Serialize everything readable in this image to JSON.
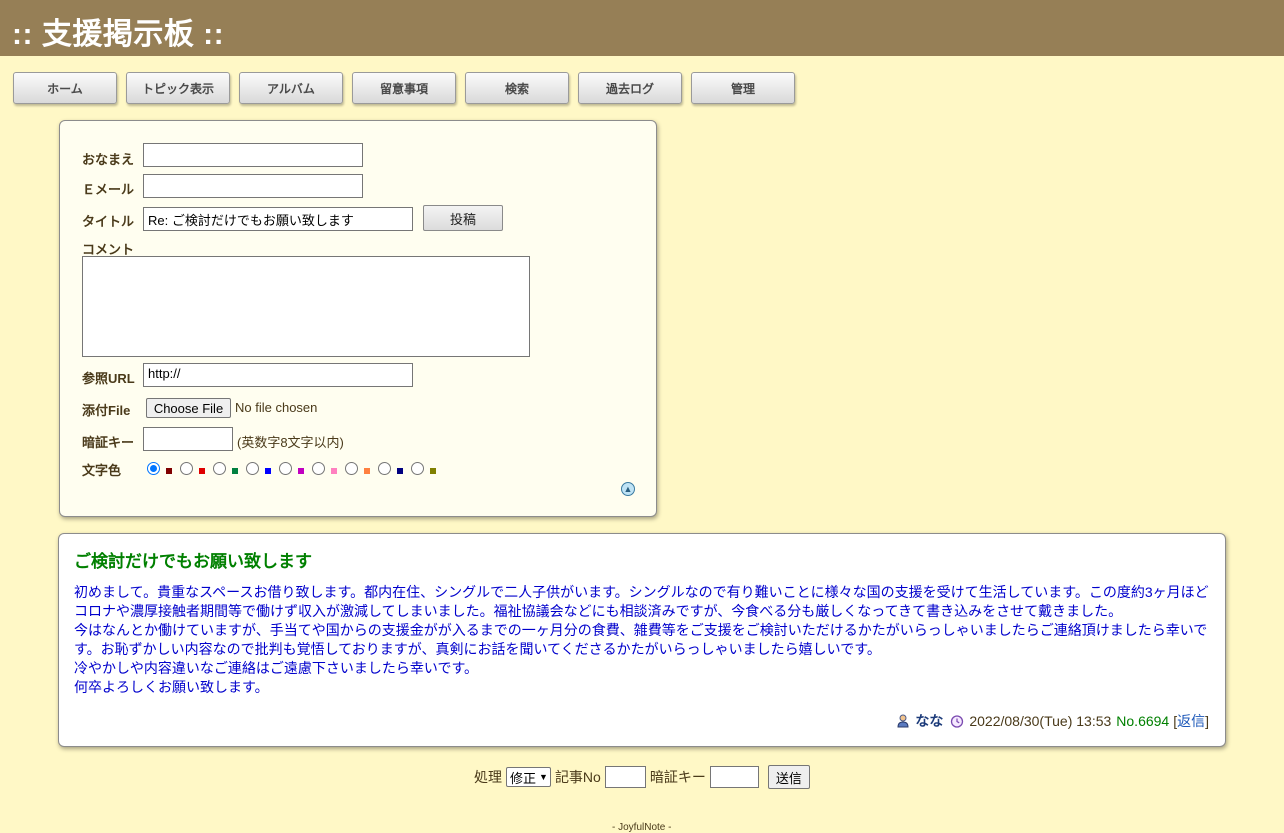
{
  "header": {
    "title": ":: 支援掲示板 ::"
  },
  "nav": [
    {
      "label": "ホーム"
    },
    {
      "label": "トピック表示"
    },
    {
      "label": "アルバム"
    },
    {
      "label": "留意事項"
    },
    {
      "label": "検索"
    },
    {
      "label": "過去ログ"
    },
    {
      "label": "管理"
    }
  ],
  "form": {
    "name_label": "おなまえ",
    "email_label": "Ｅメール",
    "title_label": "タイトル",
    "title_value": "Re: ご検討だけでもお願い致します",
    "post_button": "投稿",
    "comment_label": "コメント",
    "url_label": "参照URL",
    "url_value": "http://",
    "file_label": "添付File",
    "choose_file": "Choose File",
    "no_file": "No file chosen",
    "key_label": "暗証キー",
    "key_hint": "(英数字8文字以内)",
    "color_label": "文字色",
    "colors": [
      "#800000",
      "#df0000",
      "#008040",
      "#0000ff",
      "#c100c1",
      "#ff80c0",
      "#ff8040",
      "#000080",
      "#808000"
    ],
    "selected_color_index": 0
  },
  "post": {
    "title": "ご検討だけでもお願い致します",
    "body": [
      "初めまして。貴重なスペースお借り致します。都内在住、シングルで二人子供がいます。シングルなので有り難いことに様々な国の支援を受けて生活しています。この度約3ヶ月ほどコロナや濃厚接触者期間等で働けず収入が激減してしまいました。福祉協議会などにも相談済みですが、今食べる分も厳しくなってきて書き込みをさせて戴きました。",
      "今はなんとか働けていますが、手当てや国からの支援金がが入るまでの一ヶ月分の食費、雑費等をご支援をご検討いただけるかたがいらっしゃいましたらご連絡頂けましたら幸いです。お恥ずかしい内容なので批判も覚悟しておりますが、真剣にお話を聞いてくださるかたがいらっしゃいましたら嬉しいです。",
      "冷やかしや内容違いなご連絡はご遠慮下さいましたら幸いです。",
      "何卒よろしくお願い致します。"
    ],
    "author": "なな",
    "date": "2022/08/30(Tue) 13:53",
    "number": "No.6694",
    "reply_open": "[",
    "reply_label": "返信",
    "reply_close": "]"
  },
  "bottom": {
    "process_label": "処理",
    "process_value": "修正",
    "article_label": "記事No",
    "key_label": "暗証キー",
    "send_button": "送信"
  },
  "footer": {
    "text": "- JoyfulNote -"
  }
}
